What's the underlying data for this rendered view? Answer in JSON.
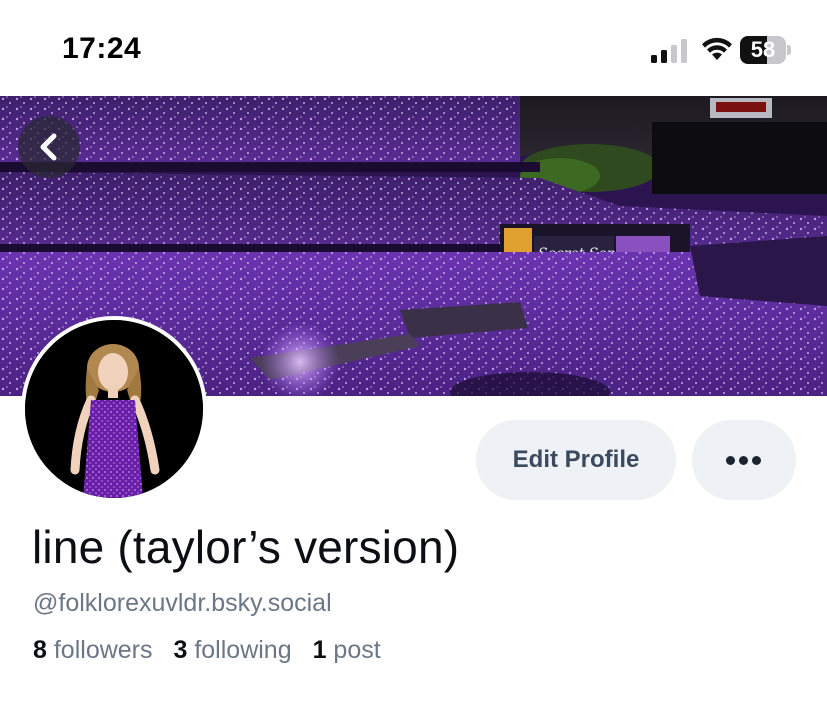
{
  "status_bar": {
    "time": "17:24",
    "battery_level": "58",
    "battery_fraction": 0.58
  },
  "header": {
    "back_icon": "chevron-left-icon"
  },
  "profile": {
    "display_name": "line (taylor’s version)",
    "handle": "@folklorexuvldr.bsky.social",
    "stats": [
      {
        "count": "8",
        "label": "followers"
      },
      {
        "count": "3",
        "label": "following"
      },
      {
        "count": "1",
        "label": "post"
      }
    ]
  },
  "actions": {
    "edit_profile_label": "Edit Profile",
    "more_icon": "more-horizontal-icon"
  },
  "colors": {
    "accent_text": "#3b4a5c",
    "button_bg": "#eef1f5",
    "muted_text": "#6b7786",
    "banner_purple": "#7a3fc2"
  }
}
